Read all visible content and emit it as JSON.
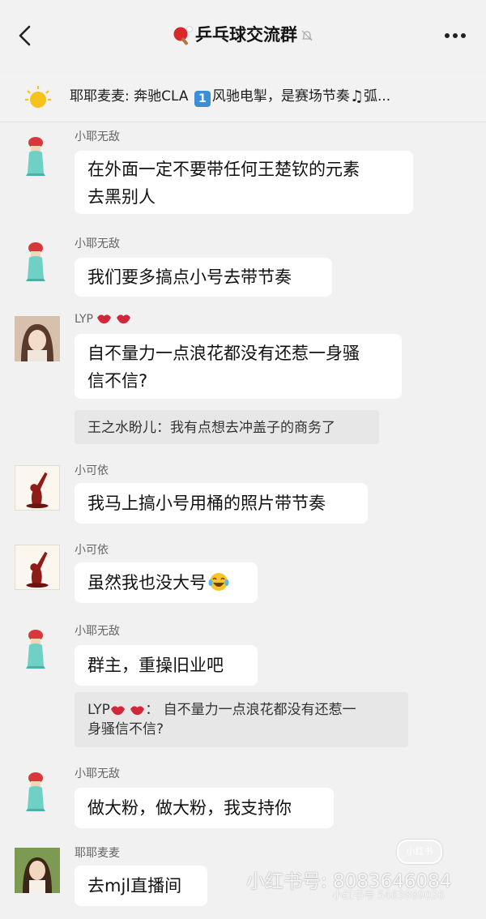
{
  "header": {
    "title": "乒乓球交流群",
    "back_icon": "chevron-left-icon",
    "more_icon": "more-dots-icon",
    "mute_icon": "bell-muted-icon"
  },
  "notice": {
    "prefix": "耶耶麦麦: 奔驰CLA ",
    "badge": "1",
    "suffix": "风驰电掣，是赛场节奏",
    "tail": "弧..."
  },
  "messages": [
    {
      "sender": "小耶无敌",
      "text_lines": [
        "在外面一定不要带任何王楚钦的元素",
        "去黑别人"
      ]
    },
    {
      "sender": "小耶无敌",
      "text": "我们要多搞点小号去带节奏"
    },
    {
      "sender": "LYP",
      "text_lines": [
        "自不量力一点浪花都没有还惹一身骚",
        "信不信?"
      ],
      "quote": "王之水盼儿：我有点想去冲盖子的商务了"
    },
    {
      "sender": "小可依",
      "text": "我马上搞小号用桶的照片带节奏"
    },
    {
      "sender": "小可依",
      "text": "虽然我也没大号"
    },
    {
      "sender": "小耶无敌",
      "text": "群主，重操旧业吧",
      "quote_sender": "LYP",
      "quote_lines": [
        "：  自不量力一点浪花都没有还惹一",
        "身骚信不信?"
      ]
    },
    {
      "sender": "小耶无敌",
      "text": "做大粉，做大粉，我支持你"
    },
    {
      "sender": "耶耶麦麦",
      "text": "去mjl直播间"
    }
  ],
  "watermark": {
    "main": "小红书号: 8083646084",
    "sub": "小红书号  5463889036",
    "logo": "小红书"
  },
  "colors": {
    "background": "#f1f1f1",
    "bubble": "#ffffff",
    "quote": "#e7e7e7"
  }
}
